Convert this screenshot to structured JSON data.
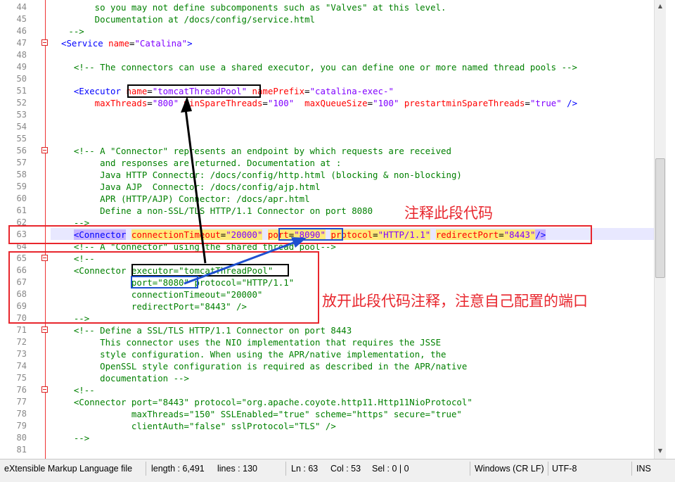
{
  "editor": {
    "line_numbers": [
      "44",
      "45",
      "46",
      "47",
      "48",
      "49",
      "50",
      "51",
      "52",
      "53",
      "54",
      "55",
      "56",
      "57",
      "58",
      "59",
      "60",
      "61",
      "62",
      "63",
      "64",
      "65",
      "66",
      "67",
      "68",
      "69",
      "70",
      "71",
      "72",
      "73",
      "74",
      "75",
      "76",
      "77",
      "78",
      "79",
      "80",
      "81"
    ],
    "lines": {
      "l44": "        so you may not define subcomponents such as \"Valves\" at this level.",
      "l45": "        Documentation at /docs/config/service.html",
      "l46": "   -->",
      "l47a": "<Service ",
      "l47b": "name",
      "l47c": "=",
      "l47d": "\"Catalina\"",
      "l47e": ">",
      "l49": "    <!-- The connectors can use a shared executor, you can define one or more named thread pools -->",
      "l51a": "    <Executor ",
      "l51b": "name",
      "l51c": "=",
      "l51d": "\"tomcatThreadPool\"",
      "l51e": " namePrefix",
      "l51f": "=",
      "l51g": "\"catalina-exec-\"",
      "l52a": "        maxThreads",
      "l52b": "=",
      "l52c": "\"800\"",
      "l52d": " minSpareThreads",
      "l52e": "=",
      "l52f": "\"100\"",
      "l52g": "  maxQueueSize",
      "l52h": "=",
      "l52i": "\"100\"",
      "l52j": " prestartminSpareThreads",
      "l52k": "=",
      "l52l": "\"true\"",
      "l52m": " />",
      "l56": "    <!-- A \"Connector\" represents an endpoint by which requests are received",
      "l57": "         and responses are returned. Documentation at :",
      "l58": "         Java HTTP Connector: /docs/config/http.html (blocking & non-blocking)",
      "l59": "         Java AJP  Connector: /docs/config/ajp.html",
      "l60": "         APR (HTTP/AJP) Connector: /docs/apr.html",
      "l61": "         Define a non-SSL/TLS HTTP/1.1 Connector on port 8080",
      "l62": "    -->",
      "l63_pad": "    ",
      "l63a": "<Connector",
      "l63b": " ",
      "l63c": "connectionTimeout",
      "l63d": "=",
      "l63e": "\"20000\"",
      "l63f": " ",
      "l63g": "port",
      "l63h": "=",
      "l63i": "\"8090\"",
      "l63j": " ",
      "l63k": "protocol",
      "l63l": "=",
      "l63m": "\"HTTP/1.1\"",
      "l63n": " ",
      "l63o": "redirectPort",
      "l63p": "=",
      "l63q": "\"8443\"",
      "l63r": "/>",
      "l64": "    <!-- A \"Connector\" using the shared thread pool-->",
      "l65": "    <!--",
      "l66a": "    <Connector ",
      "l66b": "executor",
      "l66c": "=",
      "l66d": "\"tomcatThreadPool\"",
      "l67a": "               port",
      "l67b": "=",
      "l67c": "\"8080\"",
      "l67d": " protocol",
      "l67e": "=",
      "l67f": "\"HTTP/1.1\"",
      "l68": "               connectionTimeout=\"20000\"",
      "l69": "               redirectPort=\"8443\" />",
      "l70": "    -->",
      "l71": "    <!-- Define a SSL/TLS HTTP/1.1 Connector on port 8443",
      "l72": "         This connector uses the NIO implementation that requires the JSSE",
      "l73": "         style configuration. When using the APR/native implementation, the",
      "l74": "         OpenSSL style configuration is required as described in the APR/native",
      "l75": "         documentation -->",
      "l76": "    <!--",
      "l77": "    <Connector port=\"8443\" protocol=\"org.apache.coyote.http11.Http11NioProtocol\"",
      "l78": "               maxThreads=\"150\" SSLEnabled=\"true\" scheme=\"https\" secure=\"true\"",
      "l79": "               clientAuth=\"false\" sslProtocol=\"TLS\" />",
      "l80": "    -->"
    }
  },
  "annotations": {
    "comment_this_code": "注释此段代码",
    "uncomment_this_code": "放开此段代码注释，注意自己配置的端口"
  },
  "statusbar": {
    "file_type": "eXtensible Markup Language file",
    "length": "length : 6,491",
    "lines": "lines : 130",
    "ln": "Ln : 63",
    "col": "Col : 53",
    "sel": "Sel : 0 | 0",
    "eol": "Windows (CR LF)",
    "encoding": "UTF-8",
    "mode": "INS"
  },
  "colors": {
    "tag": "#0000ff",
    "attribute": "#ff0000",
    "value": "#8000ff",
    "comment": "#008000",
    "annotation_red": "#e8262d",
    "box_blue": "#1e50d0"
  }
}
